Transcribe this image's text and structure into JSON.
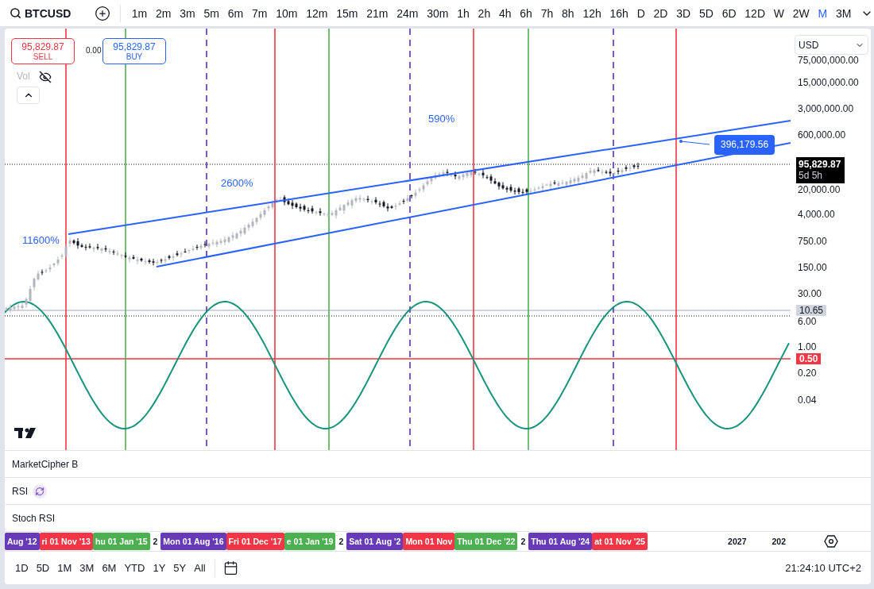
{
  "symbol": "BTCUSD",
  "timeframes": [
    {
      "label": "1m",
      "selected": false
    },
    {
      "label": "2m",
      "selected": false
    },
    {
      "label": "3m",
      "selected": false
    },
    {
      "label": "5m",
      "selected": false
    },
    {
      "label": "6m",
      "selected": false
    },
    {
      "label": "7m",
      "selected": false
    },
    {
      "label": "10m",
      "selected": false
    },
    {
      "label": "12m",
      "selected": false
    },
    {
      "label": "15m",
      "selected": false
    },
    {
      "label": "21m",
      "selected": false
    },
    {
      "label": "24m",
      "selected": false
    },
    {
      "label": "30m",
      "selected": false
    },
    {
      "label": "1h",
      "selected": false
    },
    {
      "label": "2h",
      "selected": false
    },
    {
      "label": "4h",
      "selected": false
    },
    {
      "label": "6h",
      "selected": false
    },
    {
      "label": "7h",
      "selected": false
    },
    {
      "label": "8h",
      "selected": false
    },
    {
      "label": "12h",
      "selected": false
    },
    {
      "label": "16h",
      "selected": false
    },
    {
      "label": "D",
      "selected": false
    },
    {
      "label": "2D",
      "selected": false
    },
    {
      "label": "3D",
      "selected": false
    },
    {
      "label": "5D",
      "selected": false
    },
    {
      "label": "6D",
      "selected": false
    },
    {
      "label": "12D",
      "selected": false
    },
    {
      "label": "W",
      "selected": false
    },
    {
      "label": "2W",
      "selected": false
    },
    {
      "label": "M",
      "selected": true
    },
    {
      "label": "3M",
      "selected": false
    }
  ],
  "trade": {
    "sell_price": "95,829.87",
    "sell_label": "SELL",
    "spread": "0.00",
    "buy_price": "95,829.87",
    "buy_label": "BUY"
  },
  "legend": {
    "volume_label": "Vol"
  },
  "chart": {
    "annotations": [
      "11600%",
      "2600%",
      "590%"
    ],
    "price_callout": "396,179.56"
  },
  "price_axis": {
    "currency": "USD",
    "labels": [
      "75,000,000.00",
      "15,000,000.00",
      "3,000,000.00",
      "600,000.00",
      "20,000.00",
      "4,000.00",
      "750.00",
      "150.00",
      "30.00",
      "6.00",
      "1.00",
      "0.20",
      "0.04"
    ],
    "last_price": "95,829.87",
    "countdown": "5d 5h",
    "markers": [
      {
        "text": "10.65",
        "kind": "neutral"
      },
      {
        "text": "0.50",
        "kind": "alert"
      }
    ]
  },
  "panes": [
    {
      "name": "MarketCipher B",
      "syncing": false
    },
    {
      "name": "RSI",
      "syncing": true
    },
    {
      "name": "Stoch RSI",
      "syncing": false
    }
  ],
  "time_axis": [
    {
      "text": "Aug '12",
      "kind": "tag",
      "color": "#673ab7"
    },
    {
      "text": "ri 01 Nov '13",
      "kind": "tag",
      "color": "#f23645"
    },
    {
      "text": "hu 01 Jan '15",
      "kind": "tag",
      "color": "#4caf50"
    },
    {
      "text": "2",
      "kind": "plain"
    },
    {
      "text": "Mon 01 Aug '16",
      "kind": "tag",
      "color": "#673ab7"
    },
    {
      "text": "Fri 01 Dec '17",
      "kind": "tag",
      "color": "#f23645"
    },
    {
      "text": "e 01 Jan '19",
      "kind": "tag",
      "color": "#4caf50"
    },
    {
      "text": "2",
      "kind": "plain"
    },
    {
      "text": "Sat 01 Aug '2",
      "kind": "tag",
      "color": "#673ab7"
    },
    {
      "text": "Mon 01 Nov",
      "kind": "tag",
      "color": "#f23645"
    },
    {
      "text": "Thu 01 Dec '22",
      "kind": "tag",
      "color": "#4caf50"
    },
    {
      "text": "2",
      "kind": "plain"
    },
    {
      "text": "Thu 01 Aug '24",
      "kind": "tag",
      "color": "#673ab7"
    },
    {
      "text": "at 01 Nov '25",
      "kind": "tag",
      "color": "#f23645"
    },
    {
      "text": "2027",
      "kind": "plain"
    },
    {
      "text": "202",
      "kind": "plain"
    }
  ],
  "ranges": [
    "1D",
    "5D",
    "1M",
    "3M",
    "6M",
    "YTD",
    "1Y",
    "5Y",
    "All"
  ],
  "clock": "21:24:10 UTC+2"
}
